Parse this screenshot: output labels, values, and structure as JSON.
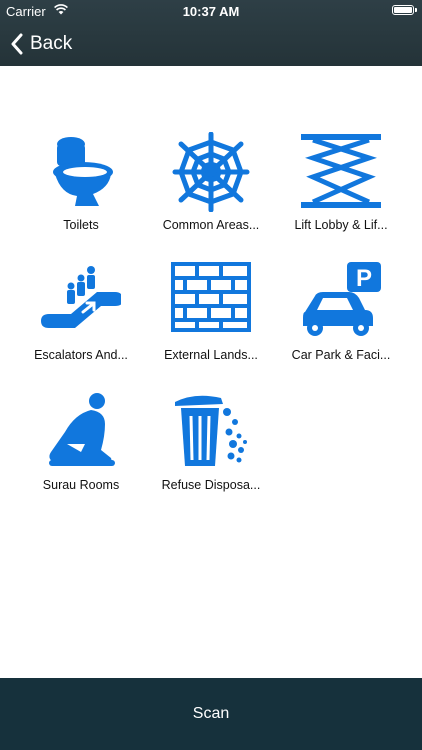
{
  "status": {
    "carrier": "Carrier",
    "time": "10:37 AM"
  },
  "nav": {
    "back_label": "Back"
  },
  "colors": {
    "icon": "#1177dd",
    "bar": "#16313c"
  },
  "categories": [
    {
      "label": "Toilets",
      "icon": "toilet-icon"
    },
    {
      "label": "Common Areas...",
      "icon": "spider-web-icon"
    },
    {
      "label": "Lift Lobby & Lif...",
      "icon": "scissor-lift-icon"
    },
    {
      "label": "Escalators And...",
      "icon": "escalator-icon"
    },
    {
      "label": "External Lands...",
      "icon": "brick-wall-icon"
    },
    {
      "label": "Car Park & Faci...",
      "icon": "car-park-icon"
    },
    {
      "label": "Surau Rooms",
      "icon": "prayer-icon"
    },
    {
      "label": "Refuse Disposa...",
      "icon": "trash-bin-icon"
    }
  ],
  "footer": {
    "scan_label": "Scan"
  }
}
